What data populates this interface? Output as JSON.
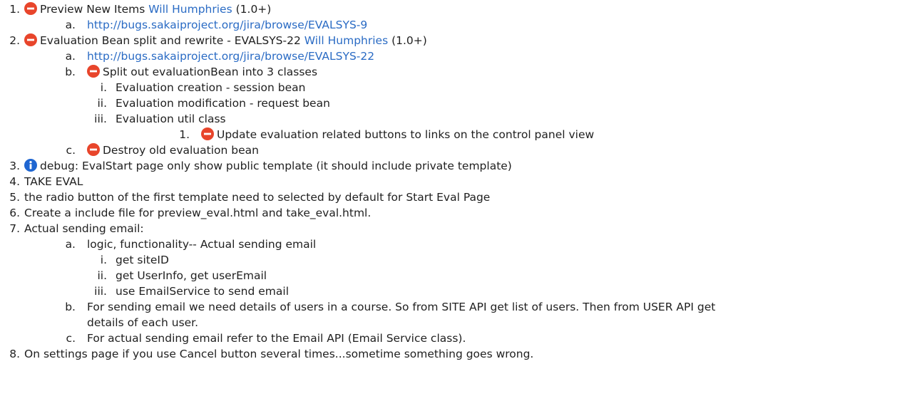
{
  "items": [
    {
      "num": "1.",
      "text_before": "Preview New Items",
      "link": "Will Humphries",
      "text_after": "(1.0+)",
      "icon": "error-icon"
    },
    {
      "num": "a.",
      "url": "http://bugs.sakaiproject.org/jira/browse/EVALSYS-9"
    },
    {
      "num": "2.",
      "text_before": "Evaluation Bean split and rewrite - EVALSYS-22",
      "link": "Will Humphries",
      "text_after": "(1.0+)",
      "icon": "error-icon"
    },
    {
      "num": "a.",
      "url": "http://bugs.sakaiproject.org/jira/browse/EVALSYS-22"
    },
    {
      "num": "b.",
      "text": "Split out evaluationBean into 3 classes",
      "icon": "error-icon"
    },
    {
      "num": "i.",
      "text": "Evaluation creation - session bean"
    },
    {
      "num": "ii.",
      "text": "Evaluation modification - request bean"
    },
    {
      "num": "iii.",
      "text": "Evaluation util class"
    },
    {
      "num": "1.",
      "text": "Update evaluation related buttons to links on the control panel view",
      "icon": "error-icon"
    },
    {
      "num": "c.",
      "text": "Destroy old evaluation bean",
      "icon": "error-icon"
    },
    {
      "num": "3.",
      "text": "debug: EvalStart page only show public template (it should include private template)",
      "icon": "info-icon"
    },
    {
      "num": "4.",
      "text": "TAKE EVAL"
    },
    {
      "num": "5.",
      "text": "the radio button of the first template need to selected by default for Start Eval Page"
    },
    {
      "num": "6.",
      "text": "Create a include file for preview_eval.html and take_eval.html."
    },
    {
      "num": "7.",
      "text": "Actual sending email:"
    },
    {
      "num": "a.",
      "text": "logic, functionality-- Actual sending email"
    },
    {
      "num": "i.",
      "text": "get siteID"
    },
    {
      "num": "ii.",
      "text": "get UserInfo, get userEmail"
    },
    {
      "num": "iii.",
      "text": "use EmailService to send email"
    },
    {
      "num": "b.",
      "text": "For sending email we need details of users in a course. So from SITE API get list of users. Then from USER API get"
    },
    {
      "num": "",
      "text": "details of each user."
    },
    {
      "num": "c.",
      "text": "For actual sending email refer to the Email API (Email Service class)."
    },
    {
      "num": "8.",
      "text": "On settings page if you use Cancel button several times...sometime something goes wrong."
    }
  ],
  "colors": {
    "error": "#e8452b",
    "info": "#1f66d1",
    "link": "#2a6bc4"
  }
}
